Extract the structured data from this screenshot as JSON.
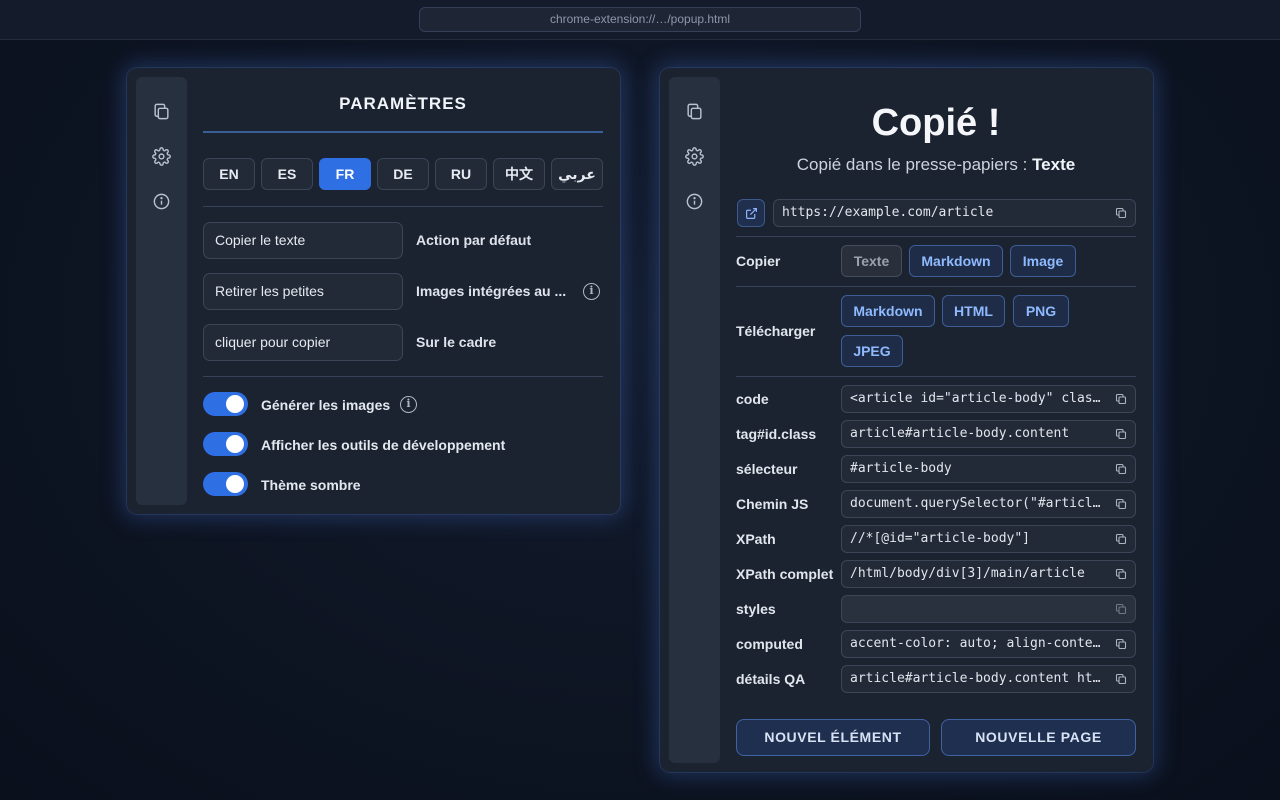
{
  "browser": {
    "url": "chrome-extension://…/popup.html"
  },
  "left": {
    "title": "PARAMÈTRES",
    "languages": [
      {
        "code": "EN",
        "active": false
      },
      {
        "code": "ES",
        "active": false
      },
      {
        "code": "FR",
        "active": true
      },
      {
        "code": "DE",
        "active": false
      },
      {
        "code": "RU",
        "active": false
      },
      {
        "code": "中文",
        "active": false
      },
      {
        "code": "عربي",
        "active": false
      }
    ],
    "settings": [
      {
        "value": "Copier le texte",
        "label": "Action par défaut"
      },
      {
        "value": "Retirer les petites",
        "label": "Images intégrées au ..."
      },
      {
        "value": "cliquer pour copier",
        "label": "Sur le cadre"
      }
    ],
    "toggles": [
      {
        "label": "Générer les images",
        "on": true
      },
      {
        "label": "Afficher les outils de développement",
        "on": true
      },
      {
        "label": "Thème sombre",
        "on": true
      }
    ]
  },
  "right": {
    "title": "Copié !",
    "subtitle_prefix": "Copié dans le presse-papiers : ",
    "subtitle_value": "Texte",
    "url": "https://example.com/article",
    "copy": {
      "label": "Copier",
      "options": [
        "Texte",
        "Markdown",
        "Image"
      ]
    },
    "download": {
      "label": "Télécharger",
      "options": [
        "Markdown",
        "HTML",
        "PNG",
        "JPEG"
      ]
    },
    "fields": [
      {
        "label": "code",
        "value": "<article id=\"article-body\" class=\"content\">"
      },
      {
        "label": "tag#id.class",
        "value": "article#article-body.content"
      },
      {
        "label": "sélecteur",
        "value": "#article-body"
      },
      {
        "label": "Chemin JS",
        "value": "document.querySelector(\"#article-body\")"
      },
      {
        "label": "XPath",
        "value": "//*[@id=\"article-body\"]"
      },
      {
        "label": "XPath complet",
        "value": "/html/body/div[3]/main/article"
      },
      {
        "label": "styles",
        "value": ""
      },
      {
        "label": "computed",
        "value": "accent-color: auto; align-content: normal;"
      },
      {
        "label": "détails QA",
        "value": "article#article-body.content https://example.com/article"
      }
    ],
    "buttons": {
      "new_element": "NOUVEL ÉLÉMENT",
      "new_page": "NOUVELLE PAGE"
    }
  },
  "colors": {
    "accent": "#2f6fe4",
    "panel": "#1b2230",
    "chip_text": "#8fbaff"
  }
}
